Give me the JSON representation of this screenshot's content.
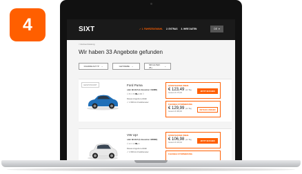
{
  "badge": {
    "number": "4"
  },
  "header": {
    "logo": "SIXT",
    "steps": [
      "✓ 1. FAHRZEUGWAHL",
      "2. EXTRAS",
      "3. IHRE DATEN"
    ],
    "language": "DE",
    "language_chevron": "▾"
  },
  "breadcrumb": "< Autovermietung",
  "page_title": "Wir haben 33 Angebote gefunden",
  "filters": [
    {
      "label": "FAHRZEUGTYP",
      "icon": "chevron-down-icon"
    },
    {
      "label": "GETRIEBE",
      "icon": "chevron-down-icon"
    },
    {
      "label": "MIN ALTER: 25+",
      "icon": "chevron-down-icon"
    }
  ],
  "chevron": "⌄",
  "cars": [
    {
      "tag": "GESPONSORT",
      "name": "Ford Puma",
      "subtitle": "oder ähnlich (Limousine / CBMR)",
      "specs": "⚇ 5  ⚏ 5  ⛟ 2  ⚙ ⚐",
      "note": "Dieses Angebot enthält",
      "note2": "✓ 1.500 km Freikilometer",
      "body_color": "#1f6fb8",
      "offers": [
        {
          "title": "GÜNSTIGSTER PREIS",
          "price": "€ 123,49",
          "unit": "pro Tag",
          "total": "Gesamt € 370,46",
          "button": "JETZT BUCHEN"
        },
        {
          "title": "FLEXIBLE STORNIERUNG",
          "price": "€ 129,99",
          "unit": "pro Tag",
          "total": "Gesamt € 389,96",
          "button": "DETAILS ZEIGEN"
        }
      ]
    },
    {
      "tag": "",
      "name": "VW Up!",
      "subtitle": "oder ähnlich (Limousine / MDMR)",
      "specs": "⚇ 4  ⚏ 2  ⛟ 1",
      "note": "Dieses Angebot enthält",
      "note2": "✓ 1.500 km Freikilometer",
      "body_color": "#e6e6e6",
      "offers": [
        {
          "title": "GÜNSTIGSTER PREIS",
          "price": "€ 106,98",
          "unit": "pro Tag",
          "total": "Gesamt € 320,94",
          "button": "JETZT BUCHEN"
        },
        {
          "title": "FLEXIBLE STORNIERUNG",
          "price": "",
          "unit": "",
          "total": "",
          "button": ""
        }
      ]
    }
  ],
  "colors": {
    "brand_orange": "#ff5f00",
    "nav_bg": "#1a1a1a"
  }
}
